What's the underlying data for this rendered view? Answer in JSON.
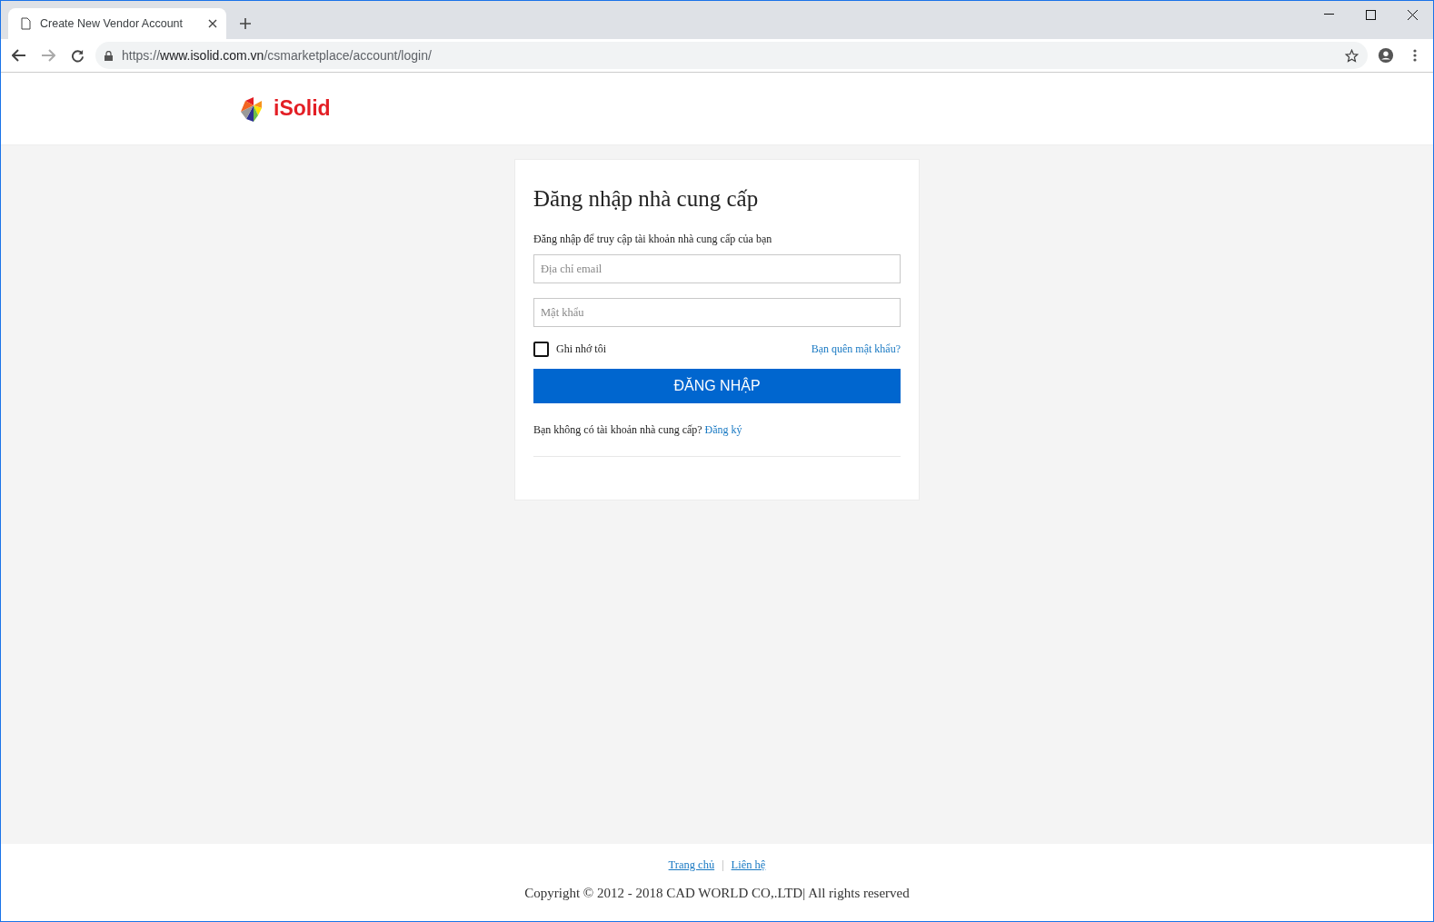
{
  "browser": {
    "tab": {
      "title": "Create New Vendor Account",
      "selected": true
    },
    "url": {
      "scheme": "https://",
      "host": "www.isolid.com.vn",
      "path": "/csmarketplace/account/login/"
    }
  },
  "header": {
    "logo_text": "iSolid"
  },
  "login": {
    "title": "Đăng nhập nhà cung cấp",
    "subtitle": "Đăng nhập để truy cập tài khoản nhà cung cấp của bạn",
    "fields": [
      {
        "placeholder": "Địa chỉ email"
      },
      {
        "placeholder": "Mật khẩu"
      }
    ],
    "remember": {
      "label": "Ghi nhớ tôi",
      "checked": false
    },
    "forgot_link": "Bạn quên mật khẩu?",
    "submit": "ĐĂNG NHẬP",
    "signup_prompt": "Bạn không có tài khoản nhà cung cấp?",
    "signup_link": "Đăng ký"
  },
  "footer": {
    "links": [
      "Trang chủ",
      "Liên hệ"
    ],
    "separator": "|",
    "copyright": "Copyright © 2012 - 2018 CAD WORLD CO,.LTD| All rights reserved"
  }
}
